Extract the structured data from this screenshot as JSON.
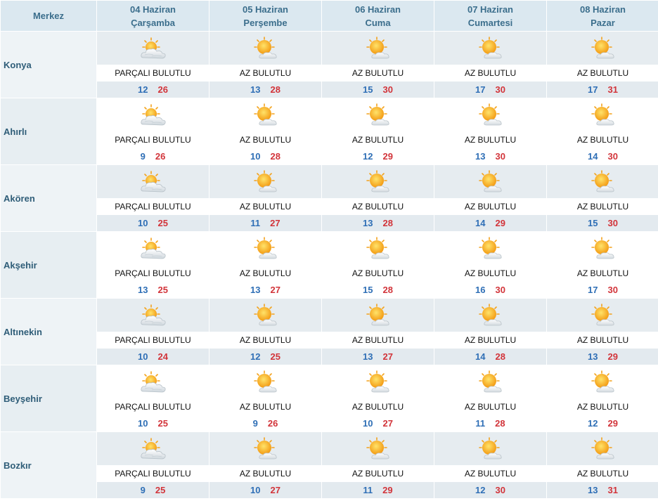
{
  "header": {
    "location_label": "Merkez",
    "days": [
      {
        "date": "04 Haziran",
        "weekday": "Çarşamba"
      },
      {
        "date": "05 Haziran",
        "weekday": "Perşembe"
      },
      {
        "date": "06 Haziran",
        "weekday": "Cuma"
      },
      {
        "date": "07 Haziran",
        "weekday": "Cumartesi"
      },
      {
        "date": "08 Haziran",
        "weekday": "Pazar"
      }
    ]
  },
  "colors": {
    "header_bg": "#dbe8f0",
    "location_text": "#2f5d78",
    "min_temp": "#2f6fb6",
    "max_temp": "#d2343a"
  },
  "rows": [
    {
      "location": "Konya",
      "days": [
        {
          "icon": "partly-cloudy-icon",
          "desc": "PARÇALI BULUTLU",
          "min": "12",
          "max": "26"
        },
        {
          "icon": "mostly-sunny-icon",
          "desc": "AZ BULUTLU",
          "min": "13",
          "max": "28"
        },
        {
          "icon": "mostly-sunny-icon",
          "desc": "AZ BULUTLU",
          "min": "15",
          "max": "30"
        },
        {
          "icon": "mostly-sunny-icon",
          "desc": "AZ BULUTLU",
          "min": "17",
          "max": "30"
        },
        {
          "icon": "mostly-sunny-icon",
          "desc": "AZ BULUTLU",
          "min": "17",
          "max": "31"
        }
      ]
    },
    {
      "location": "Ahırlı",
      "days": [
        {
          "icon": "partly-cloudy-icon",
          "desc": "PARÇALI BULUTLU",
          "min": "9",
          "max": "26"
        },
        {
          "icon": "mostly-sunny-icon",
          "desc": "AZ BULUTLU",
          "min": "10",
          "max": "28"
        },
        {
          "icon": "mostly-sunny-icon",
          "desc": "AZ BULUTLU",
          "min": "12",
          "max": "29"
        },
        {
          "icon": "mostly-sunny-icon",
          "desc": "AZ BULUTLU",
          "min": "13",
          "max": "30"
        },
        {
          "icon": "mostly-sunny-icon",
          "desc": "AZ BULUTLU",
          "min": "14",
          "max": "30"
        }
      ]
    },
    {
      "location": "Akören",
      "days": [
        {
          "icon": "partly-cloudy-icon",
          "desc": "PARÇALI BULUTLU",
          "min": "10",
          "max": "25"
        },
        {
          "icon": "mostly-sunny-icon",
          "desc": "AZ BULUTLU",
          "min": "11",
          "max": "27"
        },
        {
          "icon": "mostly-sunny-icon",
          "desc": "AZ BULUTLU",
          "min": "13",
          "max": "28"
        },
        {
          "icon": "mostly-sunny-icon",
          "desc": "AZ BULUTLU",
          "min": "14",
          "max": "29"
        },
        {
          "icon": "mostly-sunny-icon",
          "desc": "AZ BULUTLU",
          "min": "15",
          "max": "30"
        }
      ]
    },
    {
      "location": "Akşehir",
      "days": [
        {
          "icon": "partly-cloudy-icon",
          "desc": "PARÇALI BULUTLU",
          "min": "13",
          "max": "25"
        },
        {
          "icon": "mostly-sunny-icon",
          "desc": "AZ BULUTLU",
          "min": "13",
          "max": "27"
        },
        {
          "icon": "mostly-sunny-icon",
          "desc": "AZ BULUTLU",
          "min": "15",
          "max": "28"
        },
        {
          "icon": "mostly-sunny-icon",
          "desc": "AZ BULUTLU",
          "min": "16",
          "max": "30"
        },
        {
          "icon": "mostly-sunny-icon",
          "desc": "AZ BULUTLU",
          "min": "17",
          "max": "30"
        }
      ]
    },
    {
      "location": "Altınekin",
      "days": [
        {
          "icon": "partly-cloudy-icon",
          "desc": "PARÇALI BULUTLU",
          "min": "10",
          "max": "24"
        },
        {
          "icon": "mostly-sunny-icon",
          "desc": "AZ BULUTLU",
          "min": "12",
          "max": "25"
        },
        {
          "icon": "mostly-sunny-icon",
          "desc": "AZ BULUTLU",
          "min": "13",
          "max": "27"
        },
        {
          "icon": "mostly-sunny-icon",
          "desc": "AZ BULUTLU",
          "min": "14",
          "max": "28"
        },
        {
          "icon": "mostly-sunny-icon",
          "desc": "AZ BULUTLU",
          "min": "13",
          "max": "29"
        }
      ]
    },
    {
      "location": "Beyşehir",
      "days": [
        {
          "icon": "partly-cloudy-icon",
          "desc": "PARÇALI BULUTLU",
          "min": "10",
          "max": "25"
        },
        {
          "icon": "mostly-sunny-icon",
          "desc": "AZ BULUTLU",
          "min": "9",
          "max": "26"
        },
        {
          "icon": "mostly-sunny-icon",
          "desc": "AZ BULUTLU",
          "min": "10",
          "max": "27"
        },
        {
          "icon": "mostly-sunny-icon",
          "desc": "AZ BULUTLU",
          "min": "11",
          "max": "28"
        },
        {
          "icon": "mostly-sunny-icon",
          "desc": "AZ BULUTLU",
          "min": "12",
          "max": "29"
        }
      ]
    },
    {
      "location": "Bozkır",
      "days": [
        {
          "icon": "partly-cloudy-icon",
          "desc": "PARÇALI BULUTLU",
          "min": "9",
          "max": "25"
        },
        {
          "icon": "mostly-sunny-icon",
          "desc": "AZ BULUTLU",
          "min": "10",
          "max": "27"
        },
        {
          "icon": "mostly-sunny-icon",
          "desc": "AZ BULUTLU",
          "min": "11",
          "max": "29"
        },
        {
          "icon": "mostly-sunny-icon",
          "desc": "AZ BULUTLU",
          "min": "12",
          "max": "30"
        },
        {
          "icon": "mostly-sunny-icon",
          "desc": "AZ BULUTLU",
          "min": "13",
          "max": "31"
        }
      ]
    }
  ]
}
